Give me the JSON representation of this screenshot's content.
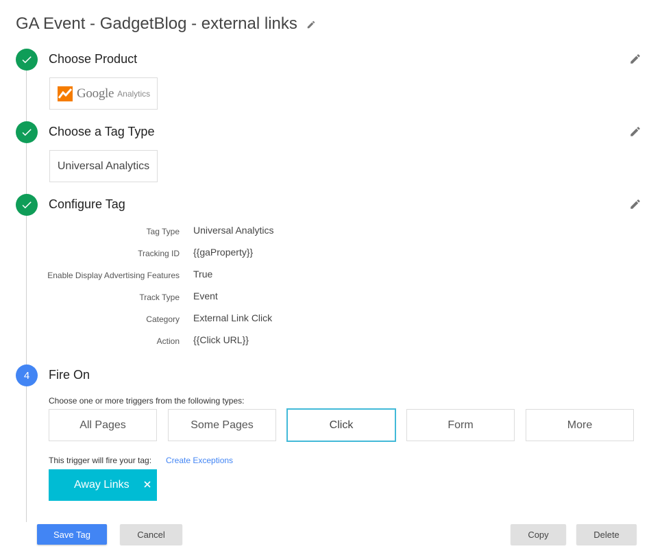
{
  "header": {
    "title": "GA Event - GadgetBlog - external links"
  },
  "steps": [
    {
      "title": "Choose Product",
      "state": "done"
    },
    {
      "title": "Choose a Tag Type",
      "state": "done"
    },
    {
      "title": "Configure Tag",
      "state": "done"
    },
    {
      "number": "4",
      "title": "Fire On",
      "state": "active"
    }
  ],
  "product": {
    "logo_word": "Google",
    "logo_sub": "Analytics"
  },
  "tag_type": {
    "value": "Universal Analytics"
  },
  "config": [
    {
      "label": "Tag Type",
      "value": "Universal Analytics"
    },
    {
      "label": "Tracking ID",
      "value": "{{gaProperty}}"
    },
    {
      "label": "Enable Display Advertising Features",
      "value": "True"
    },
    {
      "label": "Track Type",
      "value": "Event"
    },
    {
      "label": "Category",
      "value": "External Link Click"
    },
    {
      "label": "Action",
      "value": "{{Click URL}}"
    }
  ],
  "fire_on": {
    "instructions": "Choose one or more triggers from the following types:",
    "triggers": [
      "All Pages",
      "Some Pages",
      "Click",
      "Form",
      "More"
    ],
    "selected_trigger": "Click",
    "fire_text": "This trigger will fire your tag:",
    "exceptions_link": "Create Exceptions",
    "active_trigger_chip": "Away Links"
  },
  "actions": {
    "save": "Save Tag",
    "cancel": "Cancel",
    "copy": "Copy",
    "delete": "Delete"
  },
  "colors": {
    "done": "#0f9d58",
    "active": "#4285f4",
    "chip": "#00bcd4",
    "link": "#4285f4"
  }
}
